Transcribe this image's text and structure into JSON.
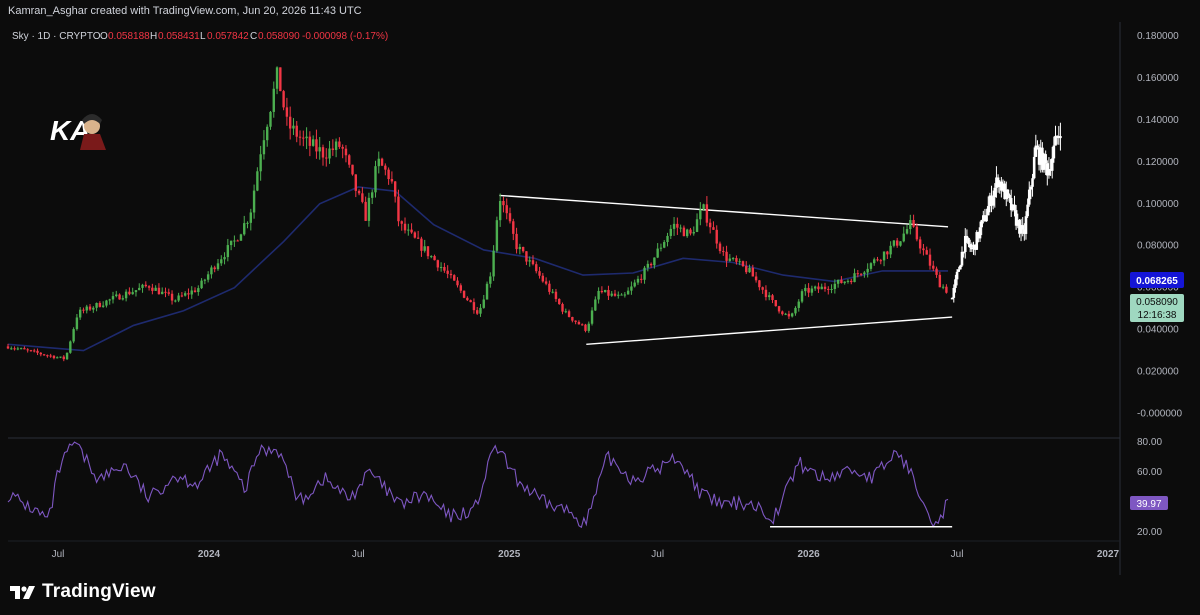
{
  "header": {
    "credit": "Kamran_Asghar created with TradingView.com, Jun 20, 2026 11:43 UTC"
  },
  "legend": {
    "symbol": "Sky · 1D · CRYPTO",
    "o_label": "O",
    "o_value": "0.058188",
    "h_label": "H",
    "h_value": "0.058431",
    "l_label": "L",
    "l_value": "0.057842",
    "c_label": "C",
    "c_value": "0.058090",
    "change": "-0.000098 (-0.17%)"
  },
  "watermark": {
    "text": "KA"
  },
  "price_axis": {
    "ticks": [
      "0.180000",
      "0.160000",
      "0.140000",
      "0.120000",
      "0.100000",
      "0.080000",
      "0.060000",
      "0.040000",
      "0.020000",
      "-0.000000"
    ],
    "ma_label": "0.068265",
    "price_label": "0.058090",
    "countdown": "12:16:38"
  },
  "rsi_axis": {
    "ticks": [
      "80.00",
      "60.00",
      "40.00",
      "20.00"
    ],
    "value_label": "39.97"
  },
  "time_axis": {
    "labels": [
      "Jul",
      "2024",
      "Jul",
      "2025",
      "Jul",
      "2026",
      "Jul",
      "2027"
    ]
  },
  "footer": {
    "brand": "TradingView"
  },
  "colors": {
    "background": "#0c0c0c",
    "up": "#4caf50",
    "down": "#f23645",
    "ma": "#1e2a6e",
    "ma_label_bg": "#1515d6",
    "rsi": "#7e57c2",
    "rsi_label_bg": "#7e57c2",
    "price_label_bg": "#9fd8c0",
    "trendline": "#ffffff",
    "projection": "#ffffff"
  },
  "chart_data": [
    {
      "type": "candlestick",
      "title": "Sky · 1D · CRYPTO",
      "x_axis_type": "date",
      "ylim": [
        -0.005,
        0.185
      ],
      "ylabel": "",
      "series": [
        {
          "kind": "price_path",
          "points": [
            [
              "2023-05-01",
              0.032
            ],
            [
              "2023-06-15",
              0.028
            ],
            [
              "2023-07-10",
              0.026
            ],
            [
              "2023-07-25",
              0.048
            ],
            [
              "2023-08-20",
              0.052
            ],
            [
              "2023-09-20",
              0.057
            ],
            [
              "2023-10-20",
              0.061
            ],
            [
              "2023-11-20",
              0.054
            ],
            [
              "2023-12-20",
              0.06
            ],
            [
              "2024-01-10",
              0.072
            ],
            [
              "2024-02-01",
              0.082
            ],
            [
              "2024-02-20",
              0.095
            ],
            [
              "2024-03-05",
              0.128
            ],
            [
              "2024-03-25",
              0.162
            ],
            [
              "2024-04-05",
              0.138
            ],
            [
              "2024-04-25",
              0.13
            ],
            [
              "2024-05-20",
              0.124
            ],
            [
              "2024-06-10",
              0.128
            ],
            [
              "2024-06-25",
              0.11
            ],
            [
              "2024-07-10",
              0.094
            ],
            [
              "2024-07-25",
              0.12
            ],
            [
              "2024-08-10",
              0.112
            ],
            [
              "2024-08-20",
              0.09
            ],
            [
              "2024-09-10",
              0.082
            ],
            [
              "2024-10-10",
              0.07
            ],
            [
              "2024-11-10",
              0.055
            ],
            [
              "2024-11-25",
              0.048
            ],
            [
              "2024-12-10",
              0.068
            ],
            [
              "2024-12-20",
              0.104
            ],
            [
              "2025-01-10",
              0.08
            ],
            [
              "2025-02-10",
              0.064
            ],
            [
              "2025-03-10",
              0.048
            ],
            [
              "2025-04-05",
              0.04
            ],
            [
              "2025-04-20",
              0.058
            ],
            [
              "2025-05-20",
              0.055
            ],
            [
              "2025-06-20",
              0.07
            ],
            [
              "2025-07-20",
              0.09
            ],
            [
              "2025-08-10",
              0.085
            ],
            [
              "2025-08-25",
              0.098
            ],
            [
              "2025-09-20",
              0.075
            ],
            [
              "2025-10-20",
              0.068
            ],
            [
              "2025-11-20",
              0.052
            ],
            [
              "2025-12-10",
              0.045
            ],
            [
              "2025-12-25",
              0.058
            ],
            [
              "2026-01-20",
              0.06
            ],
            [
              "2026-02-20",
              0.064
            ],
            [
              "2026-03-20",
              0.072
            ],
            [
              "2026-04-20",
              0.082
            ],
            [
              "2026-05-05",
              0.09
            ],
            [
              "2026-05-20",
              0.078
            ],
            [
              "2026-06-10",
              0.062
            ],
            [
              "2026-06-20",
              0.058
            ]
          ]
        },
        {
          "kind": "moving_average",
          "points": [
            [
              "2023-05-01",
              0.033
            ],
            [
              "2023-08-01",
              0.03
            ],
            [
              "2023-10-01",
              0.042
            ],
            [
              "2023-12-01",
              0.049
            ],
            [
              "2024-02-01",
              0.06
            ],
            [
              "2024-04-01",
              0.082
            ],
            [
              "2024-05-15",
              0.1
            ],
            [
              "2024-07-01",
              0.108
            ],
            [
              "2024-08-15",
              0.106
            ],
            [
              "2024-10-01",
              0.09
            ],
            [
              "2024-12-01",
              0.078
            ],
            [
              "2025-02-01",
              0.074
            ],
            [
              "2025-04-01",
              0.066
            ],
            [
              "2025-06-01",
              0.067
            ],
            [
              "2025-08-01",
              0.074
            ],
            [
              "2025-10-01",
              0.072
            ],
            [
              "2025-12-01",
              0.066
            ],
            [
              "2026-02-01",
              0.063
            ],
            [
              "2026-04-01",
              0.068
            ],
            [
              "2026-06-20",
              0.068
            ]
          ]
        },
        {
          "kind": "projection",
          "points": [
            [
              "2026-06-25",
              0.055
            ],
            [
              "2026-07-10",
              0.082
            ],
            [
              "2026-07-20",
              0.078
            ],
            [
              "2026-08-05",
              0.095
            ],
            [
              "2026-08-20",
              0.112
            ],
            [
              "2026-09-05",
              0.098
            ],
            [
              "2026-09-20",
              0.084
            ],
            [
              "2026-10-05",
              0.126
            ],
            [
              "2026-10-20",
              0.116
            ],
            [
              "2026-11-05",
              0.138
            ]
          ]
        }
      ],
      "trendlines": [
        {
          "from": [
            "2024-12-20",
            0.104
          ],
          "to": [
            "2026-06-20",
            0.089
          ]
        },
        {
          "from": [
            "2025-04-05",
            0.033
          ],
          "to": [
            "2026-06-25",
            0.046
          ]
        }
      ],
      "annotations": [
        {
          "label": "0.068265",
          "value": 0.068265
        },
        {
          "label": "0.058090",
          "value": 0.05809
        }
      ]
    },
    {
      "type": "line",
      "title": "",
      "x_axis_type": "date",
      "ylim": [
        15,
        82
      ],
      "series": [
        {
          "kind": "rsi",
          "points": [
            [
              "2023-05-01",
              45
            ],
            [
              "2023-06-01",
              35
            ],
            [
              "2023-06-20",
              28
            ],
            [
              "2023-07-01",
              60
            ],
            [
              "2023-07-20",
              80
            ],
            [
              "2023-08-20",
              55
            ],
            [
              "2023-09-20",
              65
            ],
            [
              "2023-10-20",
              42
            ],
            [
              "2023-11-20",
              58
            ],
            [
              "2023-12-20",
              52
            ],
            [
              "2024-01-15",
              72
            ],
            [
              "2024-02-15",
              48
            ],
            [
              "2024-03-01",
              74
            ],
            [
              "2024-03-25",
              76
            ],
            [
              "2024-04-20",
              40
            ],
            [
              "2024-05-20",
              56
            ],
            [
              "2024-06-20",
              42
            ],
            [
              "2024-07-15",
              60
            ],
            [
              "2024-08-20",
              38
            ],
            [
              "2024-09-20",
              45
            ],
            [
              "2024-10-20",
              30
            ],
            [
              "2024-11-20",
              35
            ],
            [
              "2024-12-15",
              78
            ],
            [
              "2025-01-10",
              55
            ],
            [
              "2025-02-10",
              40
            ],
            [
              "2025-03-10",
              35
            ],
            [
              "2025-04-05",
              26
            ],
            [
              "2025-05-01",
              70
            ],
            [
              "2025-06-01",
              55
            ],
            [
              "2025-07-01",
              62
            ],
            [
              "2025-07-25",
              70
            ],
            [
              "2025-08-25",
              44
            ],
            [
              "2025-09-20",
              38
            ],
            [
              "2025-10-20",
              40
            ],
            [
              "2025-11-20",
              30
            ],
            [
              "2025-12-20",
              66
            ],
            [
              "2026-01-20",
              55
            ],
            [
              "2026-02-20",
              62
            ],
            [
              "2026-03-20",
              56
            ],
            [
              "2026-04-20",
              74
            ],
            [
              "2026-05-20",
              44
            ],
            [
              "2026-06-05",
              24
            ],
            [
              "2026-06-20",
              39.97
            ]
          ]
        }
      ],
      "trendlines": [
        {
          "from": [
            "2025-11-15",
            23.5
          ],
          "to": [
            "2026-06-25",
            23.5
          ]
        }
      ]
    }
  ]
}
